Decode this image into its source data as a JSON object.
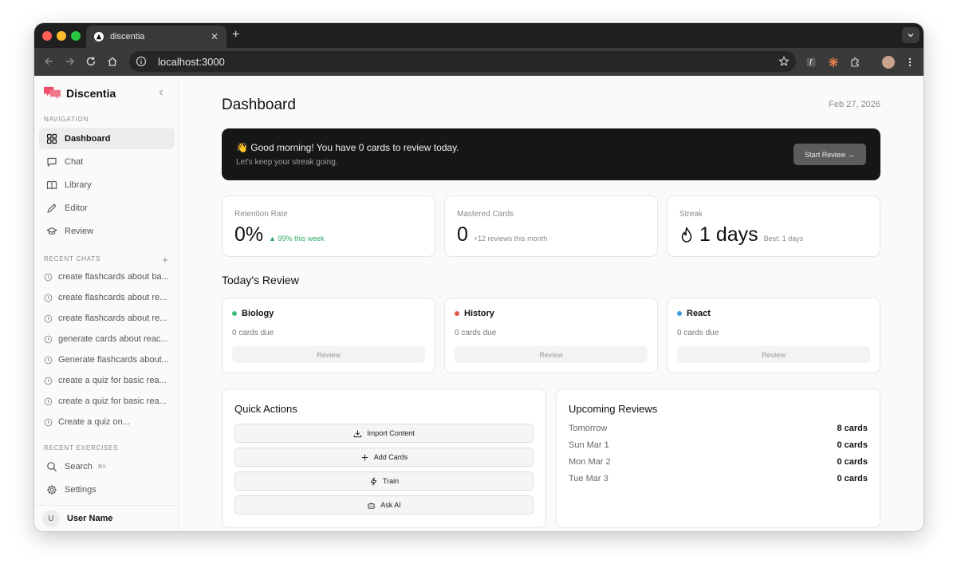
{
  "browser": {
    "tab_title": "discentia",
    "url": "localhost:3000"
  },
  "sidebar": {
    "brand": "Discentia",
    "nav_label": "NAVIGATION",
    "nav": [
      {
        "label": "Dashboard",
        "icon": "dashboard-icon"
      },
      {
        "label": "Chat",
        "icon": "chat-icon"
      },
      {
        "label": "Library",
        "icon": "book-icon"
      },
      {
        "label": "Editor",
        "icon": "pencil-icon"
      },
      {
        "label": "Review",
        "icon": "graduation-cap-icon"
      }
    ],
    "recent_chats_label": "RECENT CHATS",
    "recent_chats": [
      "create flashcards about ba...",
      "create flashcards about re...",
      "create flashcards about re...",
      "generate cards about reac...",
      "Generate flashcards about...",
      "create a quiz for basic rea...",
      "create a quiz for basic rea...",
      "Create a quiz on..."
    ],
    "recent_exercises_label": "RECENT EXERCISES",
    "search_label": "Search",
    "search_shortcut": "⌘K",
    "settings_label": "Settings",
    "user_initial": "U",
    "user_name": "User Name"
  },
  "header": {
    "title": "Dashboard",
    "date": "Feb 27, 2026"
  },
  "banner": {
    "title": "👋 Good morning! You have 0 cards to review today.",
    "subtitle": "Let's keep your streak going.",
    "button": "Start Review →"
  },
  "stats": [
    {
      "label": "Retention Rate",
      "value": "0%",
      "note": "▲ 99% this week"
    },
    {
      "label": "Mastered Cards",
      "value": "0",
      "note": "+12 reviews this month"
    },
    {
      "label": "Streak",
      "value": "1 days",
      "note": "Best: 1 days"
    }
  ],
  "todays_review": {
    "title": "Today's Review",
    "decks": [
      {
        "name": "Biology",
        "due": "0 cards due",
        "button": "Review",
        "color": "#3dbf7a"
      },
      {
        "name": "History",
        "due": "0 cards due",
        "button": "Review",
        "color": "#e5534b"
      },
      {
        "name": "React",
        "due": "0 cards due",
        "button": "Review",
        "color": "#3a9fd8"
      }
    ]
  },
  "quick_actions": {
    "title": "Quick Actions",
    "buttons": [
      {
        "label": "Import Content",
        "icon": "download-icon"
      },
      {
        "label": "Add Cards",
        "icon": "plus-icon"
      },
      {
        "label": "Train",
        "icon": "bolt-icon"
      },
      {
        "label": "Ask AI",
        "icon": "bot-icon"
      }
    ]
  },
  "upcoming": {
    "title": "Upcoming Reviews",
    "rows": [
      {
        "date": "Tomorrow",
        "count": "8 cards"
      },
      {
        "date": "Sun Mar 1",
        "count": "0 cards"
      },
      {
        "date": "Mon Mar 2",
        "count": "0 cards"
      },
      {
        "date": "Tue Mar 3",
        "count": "0 cards"
      }
    ]
  },
  "colors": {
    "brand": "#ef4f6b",
    "banner_bg": "#161616",
    "positive": "#2fa868"
  }
}
